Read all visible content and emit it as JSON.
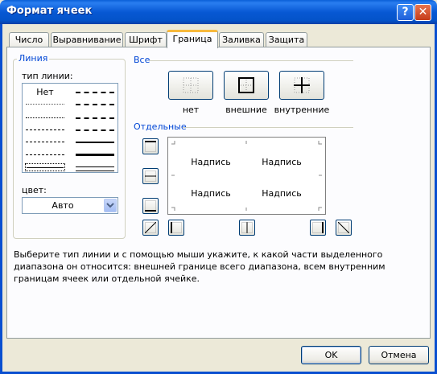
{
  "window": {
    "title": "Формат ячеек",
    "help_label": "?",
    "close_label": "✕"
  },
  "tabs": [
    {
      "label": "Число"
    },
    {
      "label": "Выравнивание"
    },
    {
      "label": "Шрифт"
    },
    {
      "label": "Граница",
      "active": true
    },
    {
      "label": "Заливка"
    },
    {
      "label": "Защита"
    }
  ],
  "line_group": {
    "title": "Линия",
    "type_label": "тип линии:",
    "none_label": "Нет",
    "color_label": "цвет:",
    "color_value": "Авто"
  },
  "presets_group": {
    "title": "Все",
    "items": [
      {
        "label": "нет",
        "icon": "border-none-icon"
      },
      {
        "label": "внешние",
        "icon": "border-outline-icon"
      },
      {
        "label": "внутренние",
        "icon": "border-inside-icon"
      }
    ]
  },
  "border_group": {
    "title": "Отдельные",
    "preview_texts": [
      "Надпись",
      "Надпись",
      "Надпись",
      "Надпись"
    ]
  },
  "hint": "Выберите тип линии и с помощью мыши укажите, к какой части выделенного диапазона он относится: внешней границе всего диапазона, всем внутренним границам ячеек или отдельной ячейке.",
  "buttons": {
    "ok": "OK",
    "cancel": "Отмена"
  },
  "colors": {
    "title_bar": "#0a5fd8",
    "group_title": "#0046d5",
    "active_tab_accent": "#f7b93c"
  }
}
